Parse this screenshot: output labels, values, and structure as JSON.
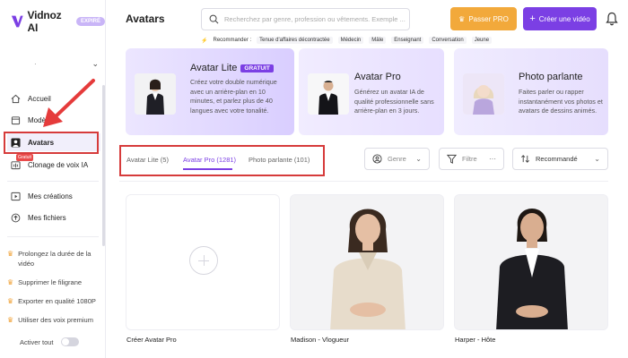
{
  "brand": {
    "name": "Vidnoz AI",
    "badge": "EXPIRÉ",
    "color": "#7b3fe4"
  },
  "sidebar": {
    "workspace_label": "·",
    "items": [
      {
        "label": "Accueil",
        "icon": "home-icon"
      },
      {
        "label": "Modèles",
        "icon": "template-icon"
      },
      {
        "label": "Avatars",
        "icon": "avatar-icon",
        "active": true
      },
      {
        "label": "Clonage de voix IA",
        "icon": "voice-clone-icon",
        "tag": "Gratuit"
      },
      {
        "label": "Mes créations",
        "icon": "play-icon"
      },
      {
        "label": "Mes fichiers",
        "icon": "upload-icon"
      }
    ],
    "promos": [
      "Prolongez la durée de la vidéo",
      "Supprimer le filigrane",
      "Exporter en qualité 1080P",
      "Utiliser des voix premium"
    ],
    "toggle_label": "Activer tout"
  },
  "header": {
    "title": "Avatars",
    "search_placeholder": "Recherchez par genre, profession ou vêtements. Exemple ...",
    "recommend_label": "Recommander :",
    "recommend_chips": [
      "Tenue d'affaires décontractée",
      "Médecin",
      "Mâle",
      "Enseignant",
      "Conversation",
      "Jeune"
    ],
    "pro_button": "Passer PRO",
    "create_button": "Créer une vidéo"
  },
  "cards": [
    {
      "title": "Avatar Lite",
      "badge": "GRATUIT",
      "desc": "Créez votre double numérique avec un arrière-plan en 10 minutes, et parlez plus de 40 langues avec votre tonalité."
    },
    {
      "title": "Avatar Pro",
      "desc": "Générez un avatar IA de qualité professionnelle sans arrière-plan en 3 jours."
    },
    {
      "title": "Photo parlante",
      "desc": "Faites parler ou rapper instantanément vos photos et avatars de dessins animés."
    }
  ],
  "tabs": [
    {
      "label": "Avatar Lite (5)"
    },
    {
      "label": "Avatar Pro (1281)",
      "active": true
    },
    {
      "label": "Photo parlante (101)"
    }
  ],
  "filters": {
    "genre": "Genre",
    "filtre": "Filtre",
    "sort": "Recommandé"
  },
  "tiles": [
    {
      "label": "Créer Avatar Pro"
    },
    {
      "label": "Madison - Vlogueur"
    },
    {
      "label": "Harper - Hôte"
    }
  ]
}
